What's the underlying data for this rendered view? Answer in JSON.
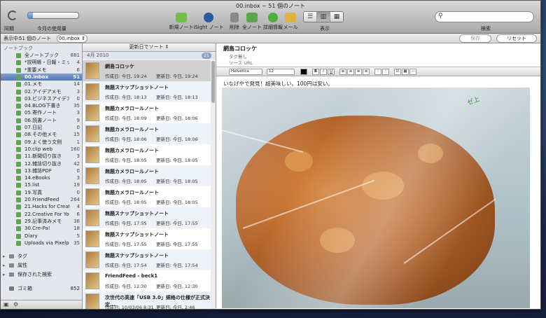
{
  "window": {
    "title": "00.inbox ~ 51 個のノート"
  },
  "toolbar": {
    "sync_label": "同期",
    "usage_label": "今月の使用量",
    "usage_fraction": 0.1,
    "buttons": [
      {
        "label": "新規ノート",
        "icon": "new-note-icon",
        "color": "#6fbf4a"
      },
      {
        "label": "iSight ノート",
        "icon": "camera-icon",
        "color": "#2c5aa0"
      },
      {
        "label": "削除",
        "icon": "trash-icon",
        "color": "#8a8a8a"
      },
      {
        "label": "全ノート",
        "icon": "all-notes-icon",
        "color": "#5aa84a"
      },
      {
        "label": "詳細情報",
        "icon": "info-icon",
        "color": "#4caf3a"
      },
      {
        "label": "メール",
        "icon": "mail-icon",
        "color": "#e0b040"
      }
    ],
    "view_label": "表示",
    "search_label": "検索"
  },
  "subbar": {
    "showing_label": "表示中:",
    "count_label": "51 個のノート",
    "notebook_value": "00.inbox",
    "save_label": "保存",
    "reset_label": "リセット"
  },
  "sidebar": {
    "header": "ノートブック",
    "notebooks": [
      {
        "label": "全ノートブック",
        "count": "881"
      },
      {
        "label": "*説明帳・日報・ミッション",
        "count": "4"
      },
      {
        "label": "*重要メモ",
        "count": "6"
      },
      {
        "label": "00.inbox",
        "count": "51",
        "selected": true
      },
      {
        "label": "01.メモ",
        "count": "14"
      },
      {
        "label": "02.アイデアメモ",
        "count": "3"
      },
      {
        "label": "03.ビジネスアイデア",
        "count": "0"
      },
      {
        "label": "04.BLOG下書き",
        "count": "35"
      },
      {
        "label": "05.寄作ノート",
        "count": "3"
      },
      {
        "label": "06.読書ノート",
        "count": "9"
      },
      {
        "label": "07.日記",
        "count": "0"
      },
      {
        "label": "08.その他メモ",
        "count": "15"
      },
      {
        "label": "09.よく使う文例",
        "count": "1"
      },
      {
        "label": "10.clip web",
        "count": "160"
      },
      {
        "label": "11.新聞切り抜き",
        "count": "3"
      },
      {
        "label": "12.雑誌切り抜き",
        "count": "42"
      },
      {
        "label": "13.雑誌PDF",
        "count": "0"
      },
      {
        "label": "14.eBooks",
        "count": "3"
      },
      {
        "label": "15.list",
        "count": "19"
      },
      {
        "label": "19.写真",
        "count": "0"
      },
      {
        "label": "20.FriendFeed",
        "count": "264"
      },
      {
        "label": "21.Hacks for Creative...",
        "count": "4"
      },
      {
        "label": "22.Creative For You!",
        "count": "6"
      },
      {
        "label": "29.記事済みメモ",
        "count": "36"
      },
      {
        "label": "30.Cre-Pa!",
        "count": "18"
      },
      {
        "label": "Diary",
        "count": "5"
      },
      {
        "label": "Uploads via Pixelpipe",
        "count": "35"
      }
    ],
    "groups": [
      {
        "label": "タグ",
        "icon": "tag-icon"
      },
      {
        "label": "属性",
        "icon": "attribute-icon"
      },
      {
        "label": "保存された検索",
        "icon": "saved-search-icon"
      }
    ],
    "trash": {
      "label": "ゴミ箱",
      "count": "852"
    }
  },
  "list": {
    "sort_label": "更新日でソート",
    "date_header": "4月 2010",
    "date_count": "21",
    "rows": [
      {
        "title": "網島コロッケ",
        "created": "作成日: 今日, 19:24",
        "updated": "更新日: 今日, 19:24",
        "selected": true
      },
      {
        "title": "無題スナップショットノート",
        "created": "作成日: 今日, 18:13",
        "updated": "更新日: 今日, 18:13"
      },
      {
        "title": "無題カメラロールノート",
        "created": "作成日: 今日, 18:09",
        "updated": "更新日: 今日, 18:06"
      },
      {
        "title": "無題カメラロールノート",
        "created": "作成日: 今日, 18:06",
        "updated": "更新日: 今日, 18:06"
      },
      {
        "title": "無題カメラロールノート",
        "created": "作成日: 今日, 18:05",
        "updated": "更新日: 今日, 18:05"
      },
      {
        "title": "無題カメラロールノート",
        "created": "作成日: 今日, 18:05",
        "updated": "更新日: 今日, 18:05"
      },
      {
        "title": "無題カメラロールノート",
        "created": "作成日: 今日, 18:05",
        "updated": "更新日: 今日, 18:05"
      },
      {
        "title": "無題スナップショットノート",
        "created": "作成日: 今日, 17:55",
        "updated": "更新日: 今日, 17:55"
      },
      {
        "title": "無題スナップショットノート",
        "created": "作成日: 今日, 17:55",
        "updated": "更新日: 今日, 17:55"
      },
      {
        "title": "無題スナップショットノート",
        "created": "作成日: 今日, 17:54",
        "updated": "更新日: 今日, 17:54"
      },
      {
        "title": "FriendFeed - beck1",
        "created": "作成日: 今日, 12:30",
        "updated": "更新日: 今日, 12:30"
      },
      {
        "title": "次世代の高速「USB 3.0」規格の仕様が正式決定...",
        "created": "作成日: 10/03/06 8:31",
        "updated": "更新日: 今日, 2:46"
      }
    ]
  },
  "detail": {
    "title": "網島コロッケ",
    "tags_placeholder": "タグ無し",
    "source_placeholder": "ソース URL",
    "font_value": "Helvetica",
    "size_value": "12",
    "body_text": "いなげやで発見！超美味しい。100円は安い。",
    "bag_print": "ゼ上"
  }
}
